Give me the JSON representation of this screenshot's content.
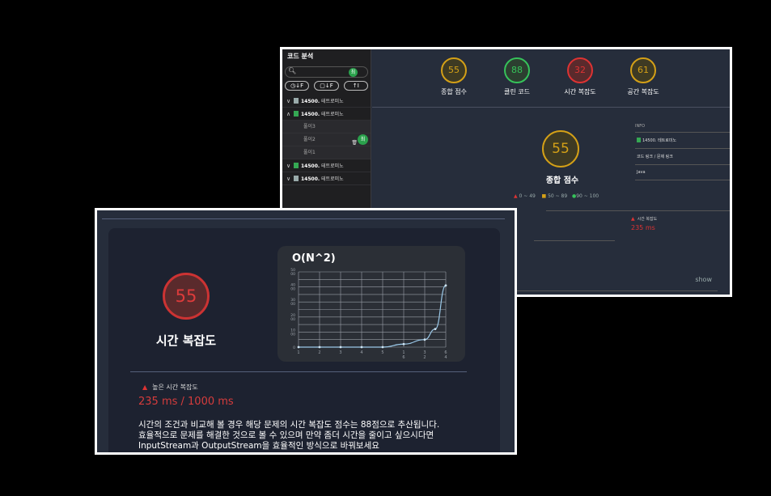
{
  "sidebar": {
    "title": "코드 분석",
    "search_badge": "최",
    "sort_buttons": [
      "◷↓F",
      "▢↓F",
      "↑I"
    ],
    "items": [
      {
        "chevron": "∨",
        "code": "14500.",
        "name": "테트로미노",
        "icon": "user"
      },
      {
        "chevron": "∧",
        "code": "14500.",
        "name": "테트로미노",
        "icon": "file"
      },
      {
        "chevron": "∨",
        "code": "14500.",
        "name": "테트로미노",
        "icon": "file"
      },
      {
        "chevron": "∨",
        "code": "14500.",
        "name": "테트로미노",
        "icon": "user"
      }
    ],
    "subitems": [
      "풀이3",
      "풀이2",
      "풀이1"
    ],
    "sub_badge": "최"
  },
  "scores": [
    {
      "label": "종합 점수",
      "value": "55",
      "color": "#d4a017"
    },
    {
      "label": "클린 코드",
      "value": "88",
      "color": "#36c25a"
    },
    {
      "label": "시간 복잡도",
      "value": "32",
      "color": "#dd3333"
    },
    {
      "label": "공간 복잡도",
      "value": "61",
      "color": "#d4a017"
    }
  ],
  "overall": {
    "value": "55",
    "label": "종합 점수",
    "legend": {
      "low": "0 ~ 49",
      "mid": "50 ~ 89",
      "high": "90 ~ 100"
    }
  },
  "info": {
    "header": "INFO",
    "problem": "14500. 테트로미노",
    "links": "코드 링크  /  문제 링크",
    "language": "Java"
  },
  "back_time": {
    "label": "시간 복잡도",
    "value": "235 ms"
  },
  "show_link": "show",
  "time_complexity": {
    "value": "55",
    "title": "시간 복잡도",
    "warning": "높은 시간 복잡도",
    "ms": "235 ms / 1000 ms",
    "description": [
      "시간의 조건과 비교해 볼 경우 해당 문제의 시간 복잡도 점수는 88점으로 추산됩니다.",
      "효율적으로 문제를 해결한 것으로 볼 수 있으며 만약 좀더 시간을 줄이고 싶으시다면",
      "InputStream과 OutputStream을 효율적인 방식으로 바꿔보세요"
    ]
  },
  "chart_data": {
    "type": "line",
    "title": "O(N^2)",
    "x_labels": [
      "1",
      "2",
      "3",
      "4",
      "5",
      "16",
      "32",
      "64"
    ],
    "y_labels": [
      "0",
      "1000",
      "2000",
      "3000",
      "4000",
      "5000"
    ],
    "x": [
      1,
      2,
      3,
      4,
      5,
      6,
      7,
      7.5,
      8
    ],
    "y": [
      0,
      0,
      0,
      0,
      0,
      200,
      500,
      1200,
      4100
    ],
    "ylim": [
      0,
      5000
    ],
    "line_color": "#9ac8e8",
    "grid": true
  }
}
